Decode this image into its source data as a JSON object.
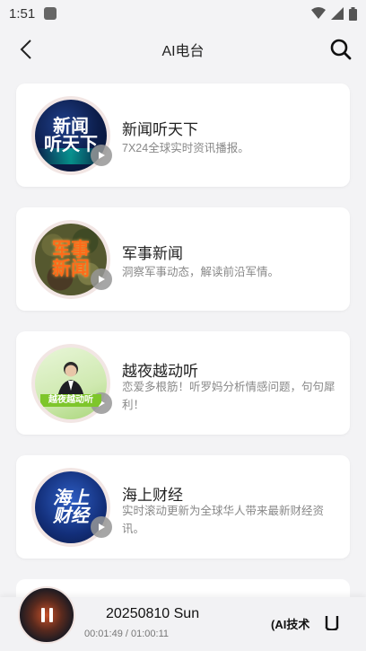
{
  "status": {
    "time": "1:51"
  },
  "header": {
    "title": "AI电台"
  },
  "cards": [
    {
      "title": "新闻听天下",
      "desc": "7X24全球实时资讯播报。",
      "cover_lines": [
        "新闻",
        "听天下"
      ]
    },
    {
      "title": "军事新闻",
      "desc": "洞察军事动态，解读前沿军情。",
      "cover_lines": [
        "军事",
        "新闻"
      ]
    },
    {
      "title": "越夜越动听",
      "desc": "恋爱多根筋！听罗妈分析情感问题，句句犀利！",
      "cover_lines": [
        "越夜越动听"
      ]
    },
    {
      "title": "海上财经",
      "desc": "实时滚动更新为全球华人带来最新财经资讯。",
      "cover_lines": [
        "海上",
        "财经"
      ]
    }
  ],
  "player": {
    "title": "20250810 Sun",
    "time": "00:01:49 / 01:00:11",
    "tag": "(AI技术"
  }
}
